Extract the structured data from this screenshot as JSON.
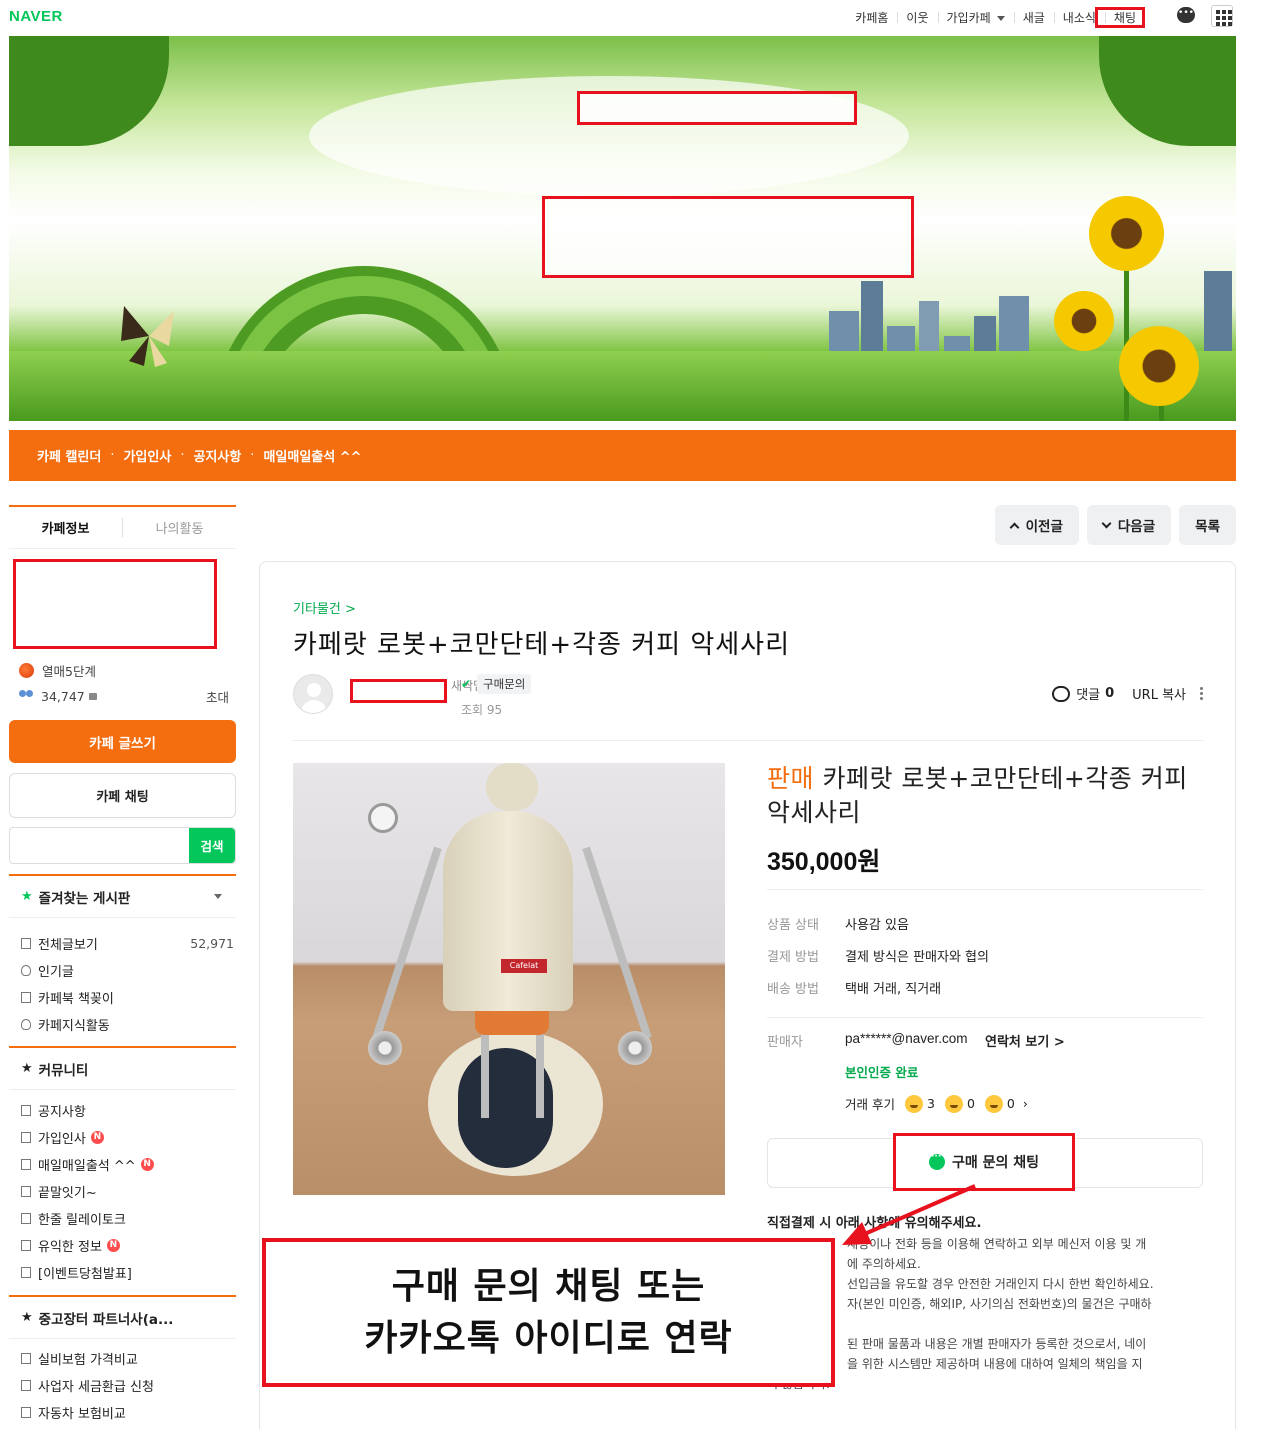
{
  "topbar": {
    "logo": "NAVER",
    "links": [
      "카페홈",
      "이웃",
      "가입카페",
      "새글",
      "내소식",
      "채팅"
    ]
  },
  "menu_bar": {
    "items": [
      "카페 캘린더",
      "가입인사",
      "공지사항",
      "매일매일출석 ^^"
    ],
    "separator": "·"
  },
  "sidebar": {
    "tabs": [
      "카페정보",
      "나의활동"
    ],
    "level": "열매5단계",
    "members": "34,747",
    "invite": "초대",
    "write_button": "카페 글쓰기",
    "chat_button": "카페 채팅",
    "search_button": "검색",
    "favorites_title": "즐겨찾는 게시판",
    "boards_top": [
      {
        "label": "전체글보기",
        "count": "52,971"
      },
      {
        "label": "인기글",
        "count": ""
      },
      {
        "label": "카페북 책꽂이",
        "count": ""
      },
      {
        "label": "카페지식활동",
        "count": ""
      }
    ],
    "community_title": "커뮤니티",
    "community": [
      {
        "label": "공지사항",
        "new": ""
      },
      {
        "label": "가입인사",
        "new": "N"
      },
      {
        "label": "매일매일출석 ^^",
        "new": "N"
      },
      {
        "label": "끝말잇기~",
        "new": ""
      },
      {
        "label": "한줄 릴레이토크",
        "new": ""
      },
      {
        "label": "유익한 정보",
        "new": "N"
      },
      {
        "label": "[이벤트당첨발표]",
        "new": ""
      }
    ],
    "partners_title": "중고장터 파트너사(a...",
    "partners": [
      "실비보험 가격비교",
      "사업자 세금환급 신청",
      "자동차 보험비교"
    ]
  },
  "article_nav": {
    "prev": "이전글",
    "next": "다음글",
    "list": "목록"
  },
  "article": {
    "category": "기타물건 >",
    "title": "카페랏 로봇+코만단테+각종 커피 악세사리",
    "member_grade": "새싹멤버",
    "buy_chip": "구매문의",
    "views": "조회 95",
    "comments_label": "댓글",
    "comments_count": "0",
    "url_copy": "URL 복사",
    "product": {
      "sale_tag": "판매",
      "title": "카페랏 로봇+코만단테+각종 커피 악세사리",
      "price": "350,000원",
      "image_label": "Cafelat",
      "specs": [
        {
          "k": "상품 상태",
          "v": "사용감 있음"
        },
        {
          "k": "결제 방법",
          "v": "결제 방식은 판매자와 협의"
        },
        {
          "k": "배송 방법",
          "v": "택배 거래, 직거래"
        }
      ],
      "seller_label": "판매자",
      "seller_email": "pa******@naver.com",
      "contact_link": "연락처 보기 >",
      "verified": "본인인증 완료",
      "review_label": "거래 후기",
      "review_counts": [
        "3",
        "0",
        "0"
      ],
      "chat_button": "구매 문의 채팅"
    },
    "notice_title": "직접결제 시 아래 사항에 유의해주세요.",
    "notice_lines": [
      "채팅이나 전화 등을 이용해 연락하고 외부 메신저 이용 및 개",
      "에 주의하세요.",
      "선입금을 유도할 경우 안전한 거래인지 다시 한번 확인하세요.",
      "자(본인 미인증, 해외IP, 사기의심 전화번호)의 물건은 구매하",
      "",
      "된 판매 물품과 내용은 개별 판매자가 등록한 것으로서, 네이",
      "을 위한 시스템만 제공하며 내용에 대하여 일체의 책임을 지",
      "지 않습니다."
    ]
  },
  "callout": {
    "line1": "구매 문의 채팅 또는",
    "line2": "카카오톡 아이디로 연락"
  },
  "colors": {
    "accent": "#f46e0f",
    "naver_green": "#03c75a",
    "highlight_red": "#e8121f"
  }
}
